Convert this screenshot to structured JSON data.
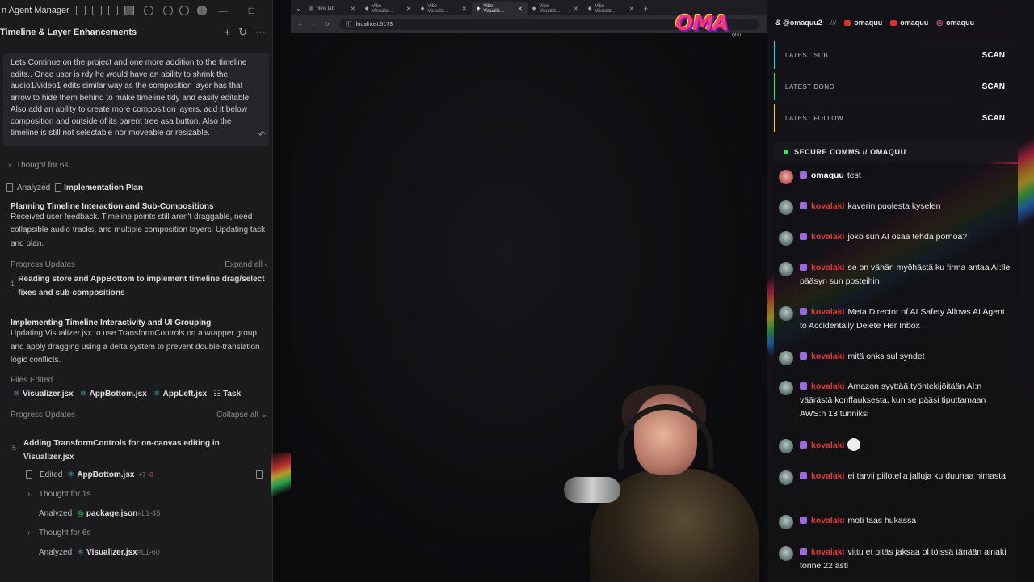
{
  "agent": {
    "app_title": "n Agent Manager",
    "window_controls": [
      "—",
      "□"
    ],
    "conversation_title": "Timeline & Layer Enhancements",
    "header_actions": [
      "+",
      "↻",
      "⋯"
    ],
    "prompt": "Lets Continue on the project and one more addition to the timeline edits.. Once user is rdy he would have an ability to shrink the audio1/video1 edits similar way as the composition layer has that arrow to hide them behind to make timeline tidy and easily editable. Also add an ability to create more composition layers. add it below composition and outside of its parent tree asa button. Also the timeline is still not selectable nor moveable or resizable.",
    "thought1": "Thought for 6s",
    "analyzed_label": "Analyzed",
    "analyzed_file": "Implementation Plan",
    "section1_title": "Planning Timeline Interaction and Sub-Compositions",
    "section1_body": "Received user feedback. Timeline points still aren't draggable, need collapsible audio tracks, and multiple composition layers. Updating task and plan.",
    "progress_label": "Progress Updates",
    "expand_all": "Expand all",
    "step1_num": "1",
    "step1_text": "Reading store and AppBottom to implement timeline drag/select fixes and sub-compositions",
    "section2_title": "Implementing Timeline Interactivity and UI Grouping",
    "section2_body": "Updating Visualizer.jsx to use TransformControls on a wrapper group and apply dragging using a delta system to prevent double-translation logic conflicts.",
    "files_edited_label": "Files Edited",
    "files": [
      "Visualizer.jsx",
      "AppBottom.jsx",
      "AppLeft.jsx",
      "Task"
    ],
    "progress_label2": "Progress Updates",
    "collapse_all": "Collapse all",
    "step5_num": "5",
    "step5_text": "Adding TransformControls for on-canvas editing in Visualizer.jsx",
    "edited_label": "Edited",
    "edited_file": "AppBottom.jsx",
    "edited_add": "+7",
    "edited_del": "-6",
    "thought2": "Thought for 1s",
    "analyzed2_label": "Analyzed",
    "analyzed2_file": "package.json",
    "analyzed2_range": "#L1-45",
    "thought3": "Thought for 6s",
    "analyzed3_label": "Analyzed",
    "analyzed3_file": "Visualizer.jsx",
    "analyzed3_range": "#L1-60"
  },
  "browser": {
    "tabs": [
      "New tab",
      "Vibe Visualiz...",
      "Vibe Visualiz...",
      "Vibe Visualiz...",
      "Vibe Visualiz...",
      "Vibe Visualiz..."
    ],
    "active_tab_index": 3,
    "url": "localhost:5173"
  },
  "overlay": {
    "logo": "OMA",
    "logo_sub": "QUU",
    "ticker": [
      "& @omaquu2",
      "///",
      "omaquu",
      "omaquu",
      "omaquu"
    ],
    "stats": [
      {
        "label": "LATEST SUB",
        "value": "SCAN"
      },
      {
        "label": "LATEST DONO",
        "value": "SCAN"
      },
      {
        "label": "LATEST FOLLOW",
        "value": "SCAN"
      }
    ],
    "comms_title": "SECURE COMMS // OMAQUU",
    "chat": [
      {
        "user": "omaquu",
        "text": "test",
        "kind": "owner"
      },
      {
        "user": "kovalaki",
        "text": "kaverin puolesta kyselen",
        "kind": "viewer"
      },
      {
        "user": "kovalaki",
        "text": "joko sun AI osaa tehdä pornoa?",
        "kind": "viewer"
      },
      {
        "user": "kovalaki",
        "text": "se on vähän myöhästä ku firma antaa AI:lle pääsyn sun posteihin",
        "kind": "viewer"
      },
      {
        "user": "kovalaki",
        "text": "Meta Director of AI Safety Allows AI Agent to Accidentally Delete Her Inbox",
        "kind": "viewer"
      },
      {
        "user": "kovalaki",
        "text": "mitä onks sul syndet",
        "kind": "viewer"
      },
      {
        "user": "kovalaki",
        "text": "Amazon syyttää työntekijöitään AI:n väärästä konffauksesta, kun se pääsi tiputtamaan AWS:n 13 tunniksi",
        "kind": "viewer"
      },
      {
        "user": "kovalaki",
        "text": "",
        "kind": "viewer"
      },
      {
        "user": "kovalaki",
        "text": "ei tarvii piilotella jalluja ku duunaa himasta",
        "kind": "viewer"
      },
      {
        "user": "kovalaki",
        "text": "moti taas hukassa",
        "kind": "viewer"
      },
      {
        "user": "kovalaki",
        "text": "vittu et pitäs jaksaa ol töissä tänään ainaki tonne 22 asti",
        "kind": "viewer"
      }
    ]
  }
}
